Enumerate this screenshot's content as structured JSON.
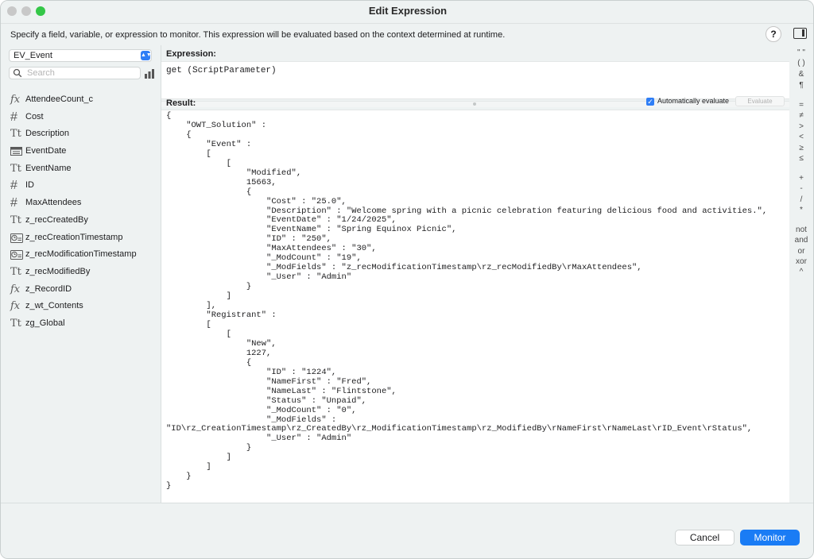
{
  "window": {
    "title": "Edit Expression"
  },
  "description": "Specify a field, variable, or expression to monitor. This expression will be evaluated based on the context determined at runtime.",
  "help_label": "?",
  "sidebar": {
    "context": "EV_Event",
    "search_placeholder": "Search",
    "fields": [
      {
        "name": "AttendeeCount_c",
        "type": "calc"
      },
      {
        "name": "Cost",
        "type": "number"
      },
      {
        "name": "Description",
        "type": "text"
      },
      {
        "name": "EventDate",
        "type": "date"
      },
      {
        "name": "EventName",
        "type": "text"
      },
      {
        "name": "ID",
        "type": "number"
      },
      {
        "name": "MaxAttendees",
        "type": "number"
      },
      {
        "name": "z_recCreatedBy",
        "type": "text"
      },
      {
        "name": "z_recCreationTimestamp",
        "type": "timestamp"
      },
      {
        "name": "z_recModificationTimestamp",
        "type": "timestamp"
      },
      {
        "name": "z_recModifiedBy",
        "type": "text"
      },
      {
        "name": "z_RecordID",
        "type": "calc"
      },
      {
        "name": "z_wt_Contents",
        "type": "calc"
      },
      {
        "name": "zg_Global",
        "type": "text"
      }
    ]
  },
  "expression": {
    "label": "Expression:",
    "value": "get (ScriptParameter)"
  },
  "result": {
    "label": "Result:",
    "auto_evaluate_label": "Automatically evaluate",
    "auto_evaluate_checked": true,
    "evaluate_label": "Evaluate",
    "text": "{\n    \"OWT_Solution\" :\n    {\n        \"Event\" :\n        [\n            [\n                \"Modified\",\n                15663,\n                {\n                    \"Cost\" : \"25.0\",\n                    \"Description\" : \"Welcome spring with a picnic celebration featuring delicious food and activities.\",\n                    \"EventDate\" : \"1/24/2025\",\n                    \"EventName\" : \"Spring Equinox Picnic\",\n                    \"ID\" : \"250\",\n                    \"MaxAttendees\" : \"30\",\n                    \"_ModCount\" : \"19\",\n                    \"_ModFields\" : \"z_recModificationTimestamp\\rz_recModifiedBy\\rMaxAttendees\",\n                    \"_User\" : \"Admin\"\n                }\n            ]\n        ],\n        \"Registrant\" :\n        [\n            [\n                \"New\",\n                1227,\n                {\n                    \"ID\" : \"1224\",\n                    \"NameFirst\" : \"Fred\",\n                    \"NameLast\" : \"Flintstone\",\n                    \"Status\" : \"Unpaid\",\n                    \"_ModCount\" : \"0\",\n                    \"_ModFields\" :\n\"ID\\rz_CreationTimestamp\\rz_CreatedBy\\rz_ModificationTimestamp\\rz_ModifiedBy\\rNameFirst\\rNameLast\\rID_Event\\rStatus\",\n                    \"_User\" : \"Admin\"\n                }\n            ]\n        ]\n    }\n}"
  },
  "operators": [
    {
      "label": "\" \""
    },
    {
      "label": "( )"
    },
    {
      "label": "&"
    },
    {
      "label": "¶"
    },
    {
      "label": "="
    },
    {
      "label": "≠"
    },
    {
      "label": ">"
    },
    {
      "label": "<"
    },
    {
      "label": "≥"
    },
    {
      "label": "≤"
    },
    {
      "label": "+"
    },
    {
      "label": "-"
    },
    {
      "label": "/"
    },
    {
      "label": "*"
    },
    {
      "label": "not"
    },
    {
      "label": "and"
    },
    {
      "label": "or"
    },
    {
      "label": "xor"
    },
    {
      "label": "^"
    }
  ],
  "footer": {
    "cancel_label": "Cancel",
    "monitor_label": "Monitor"
  },
  "colors": {
    "accent": "#1a7cf5",
    "window_bg": "#eef2f2",
    "close_active": "#34c748"
  }
}
